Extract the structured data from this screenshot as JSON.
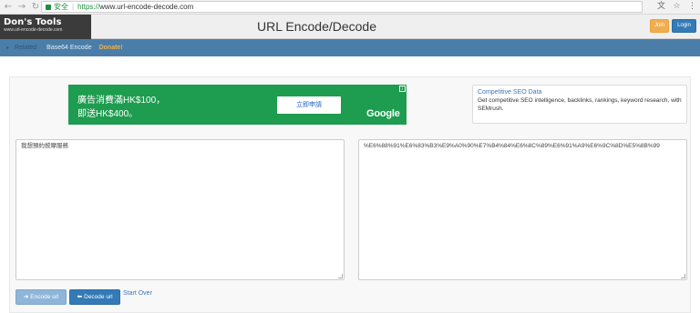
{
  "browser": {
    "back_icon": "←",
    "forward_icon": "→",
    "reload_icon": "↻",
    "secure_label": "安全",
    "url_scheme": "https://",
    "url_rest": "www.url-encode-decode.com",
    "translate_icon": "文",
    "star_icon": "☆",
    "menu_icon": "⋮"
  },
  "header": {
    "logo_title": "Don's Tools",
    "logo_sub": "www.url-encode-decode.com",
    "page_title": "URL Encode/Decode",
    "join_label": "Join",
    "login_label": "Login"
  },
  "nav": {
    "related": "Related",
    "base64": "Base64 Encode",
    "donate": "Donate!"
  },
  "ad": {
    "line1": "廣告消費滿HK$100，",
    "line2": "即送HK$400。",
    "cta": "立即申請",
    "brand": "Google",
    "info": "i"
  },
  "seo": {
    "title": "Competitive SEO Data",
    "desc": "Get competitive SEO intelligence, backlinks, rankings, keyword research, with SEMrush."
  },
  "input_text": "我想預約按摩服務",
  "output_text": "%E6%88%91%E6%83%B3%E9%A0%90%E7%B4%84%E6%8C%89%E6%91%A9%E6%9C%8D%E5%8B%99",
  "buttons": {
    "encode": "Encode url",
    "decode": "Decode url",
    "start_over": "Start Over"
  },
  "colors": {
    "nav_bg": "#4a7ea8",
    "ad_bg": "#1e9c4f",
    "primary": "#337ab7",
    "warning": "#f0ad4e"
  }
}
